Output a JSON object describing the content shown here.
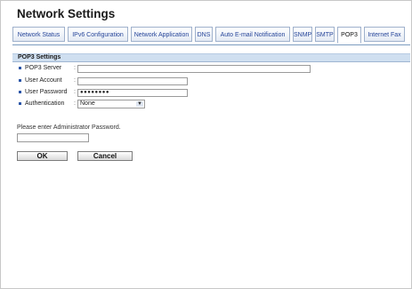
{
  "page": {
    "title": "Network Settings"
  },
  "tabs": [
    {
      "label": "Network Status"
    },
    {
      "label": "IPv6 Configuration"
    },
    {
      "label": "Network Application"
    },
    {
      "label": "DNS"
    },
    {
      "label": "Auto E-mail Notification"
    },
    {
      "label": "SNMP"
    },
    {
      "label": "SMTP"
    },
    {
      "label": "POP3",
      "active": true
    },
    {
      "label": "Internet Fax"
    }
  ],
  "section": {
    "title": "POP3 Settings"
  },
  "form": {
    "pop3_server": {
      "label": "POP3 Server",
      "value": ""
    },
    "user_account": {
      "label": "User Account",
      "value": ""
    },
    "user_password": {
      "label": "User Password",
      "value": "●●●●●●●●"
    },
    "authentication": {
      "label": "Authentication",
      "value": "None"
    }
  },
  "admin": {
    "prompt": "Please enter Administrator Password.",
    "value": ""
  },
  "buttons": {
    "ok": "OK",
    "cancel": "Cancel"
  },
  "icons": {
    "bullet": "bullet-square-icon",
    "dropdown": "chevron-down-icon"
  },
  "colors": {
    "accent": "#2c56a8",
    "section_bg": "#cfdff0",
    "tab_text": "#27469a"
  }
}
